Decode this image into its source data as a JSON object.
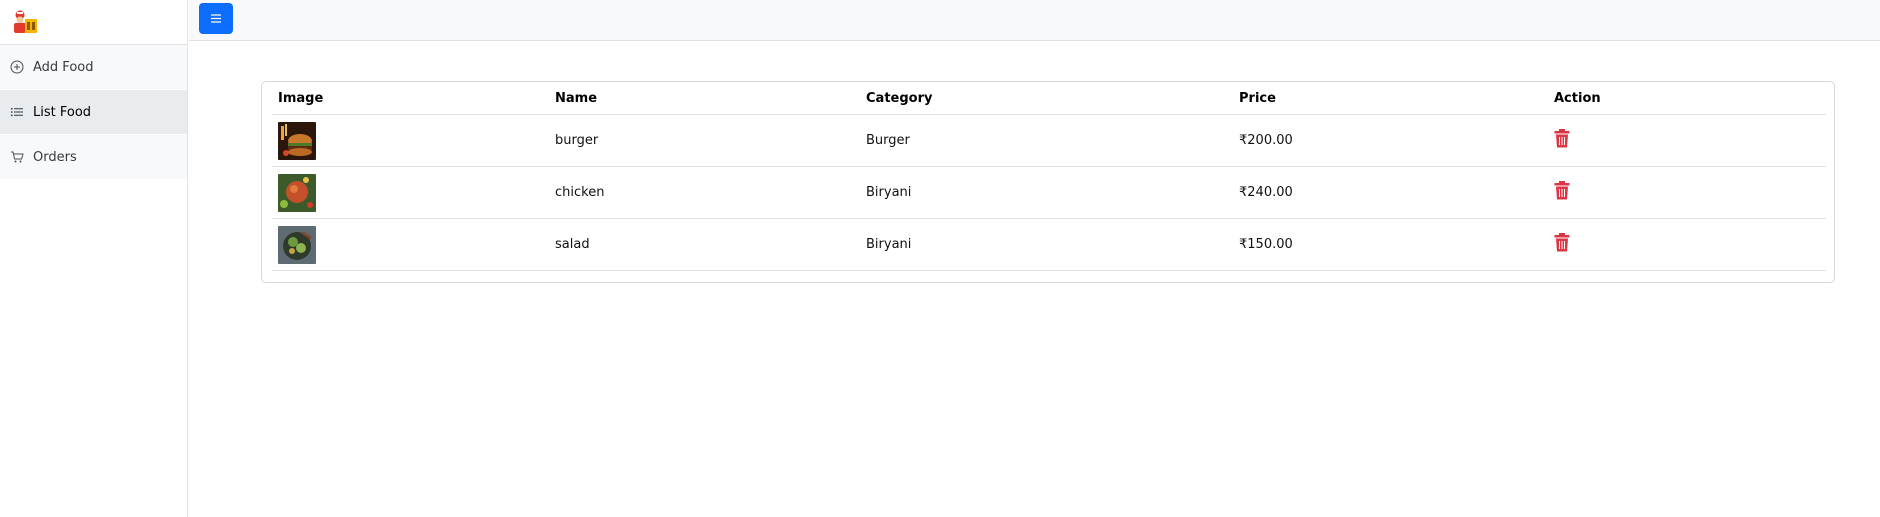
{
  "sidebar": {
    "items": [
      {
        "label": "Add Food",
        "icon": "plus-circle-icon"
      },
      {
        "label": "List Food",
        "icon": "list-icon",
        "active": true
      },
      {
        "label": "Orders",
        "icon": "cart-icon"
      }
    ]
  },
  "topbar": {
    "menu_icon": "hamburger-icon",
    "accent": "#0d6efd"
  },
  "table": {
    "headers": [
      "Image",
      "Name",
      "Category",
      "Price",
      "Action"
    ],
    "rows": [
      {
        "name": "burger",
        "category": "Burger",
        "price": "₹200.00"
      },
      {
        "name": "chicken",
        "category": "Biryani",
        "price": "₹240.00"
      },
      {
        "name": "salad",
        "category": "Biryani",
        "price": "₹150.00"
      }
    ],
    "delete_color": "#dc3545"
  }
}
